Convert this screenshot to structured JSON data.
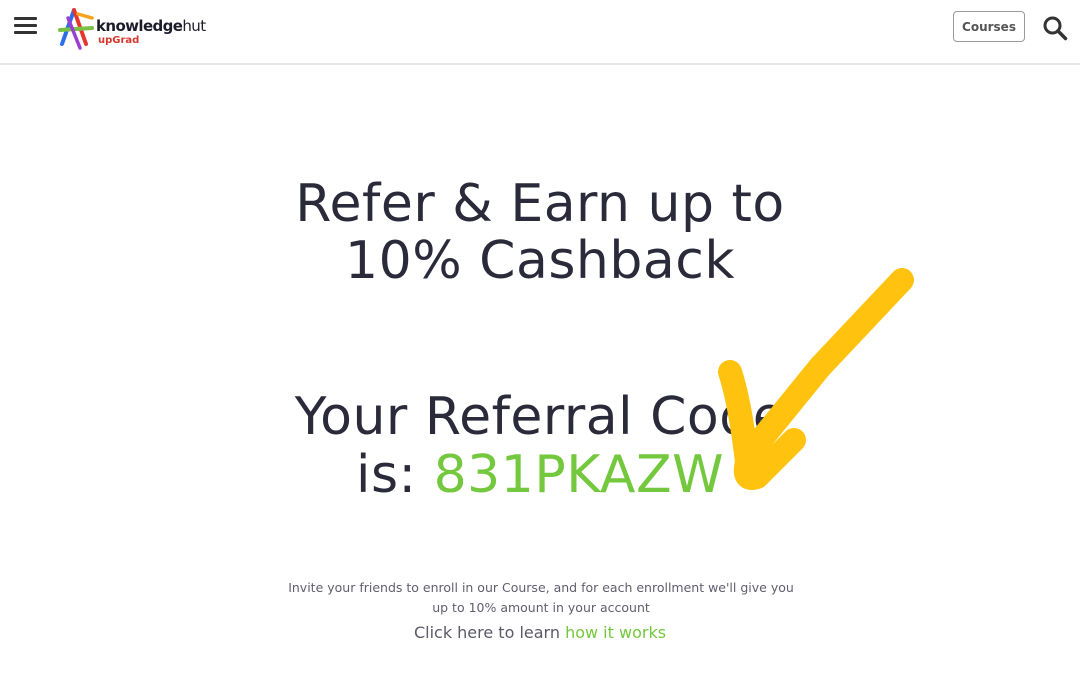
{
  "header": {
    "logo_text": {
      "bold": "knowledge",
      "normal": "hut"
    },
    "logo_sub": "upGrad",
    "courses_label": "Courses"
  },
  "hero": {
    "line1": "Refer & Earn up to",
    "line2": "10% Cashback"
  },
  "referral": {
    "line1": "Your Referral Code",
    "prefix": "is: ",
    "code": "831PKAZW"
  },
  "description": "Invite your friends to enroll in our Course, and for each enrollment we'll give you up to 10% amount in your account",
  "learn": {
    "prefix": "Click here to learn ",
    "link": "how it works"
  },
  "colors": {
    "accent_green": "#74c83e",
    "arrow_yellow": "#ffc20e",
    "logo_red": "#d5372d"
  },
  "icons": [
    "hamburger-menu-icon",
    "knowledgehut-logo",
    "search-icon",
    "arrow-pointer"
  ]
}
